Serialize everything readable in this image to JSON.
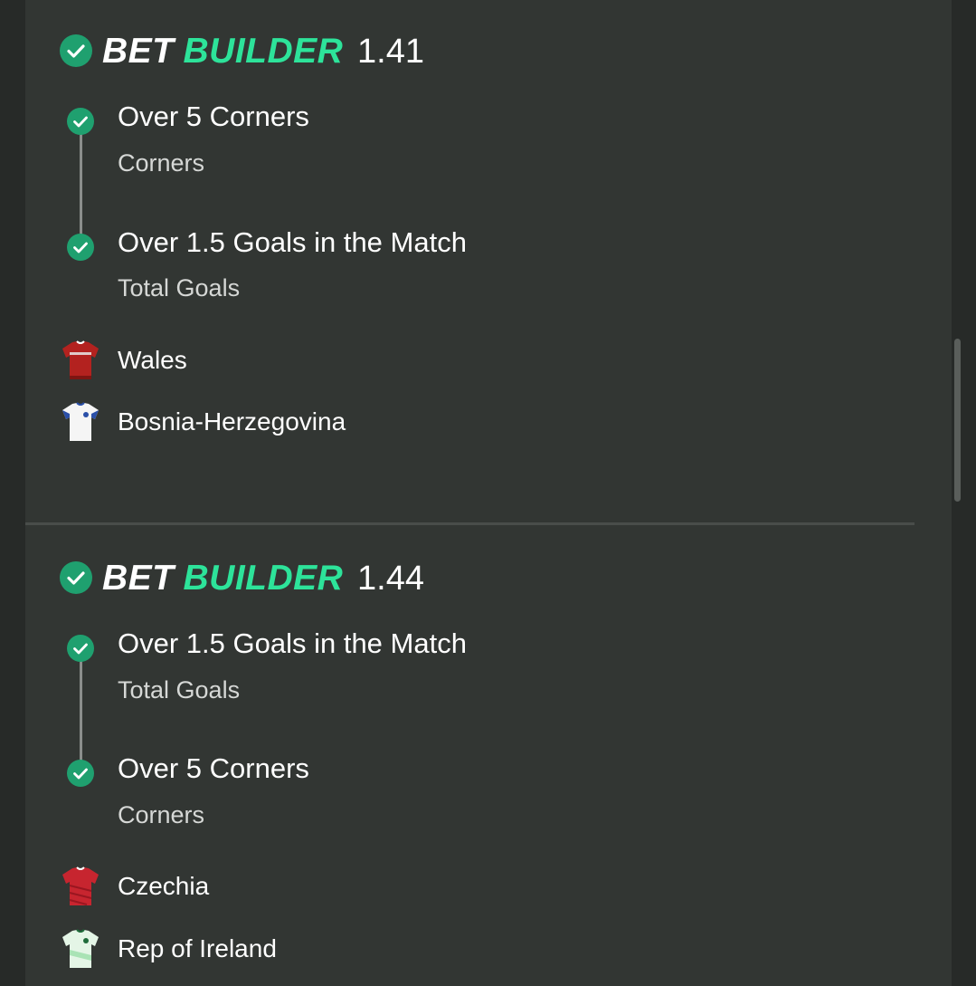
{
  "bets": [
    {
      "brand_bet": "BET",
      "brand_builder": "BUILDER",
      "odds": "1.41",
      "selections": [
        {
          "title": "Over 5 Corners",
          "market": "Corners"
        },
        {
          "title": "Over 1.5 Goals in the Match",
          "market": "Total Goals"
        }
      ],
      "teams": [
        {
          "name": "Wales",
          "shirt": "red-shirt-icon"
        },
        {
          "name": "Bosnia-Herzegovina",
          "shirt": "white-shirt-icon"
        }
      ]
    },
    {
      "brand_bet": "BET",
      "brand_builder": "BUILDER",
      "odds": "1.44",
      "selections": [
        {
          "title": "Over 1.5 Goals in the Match",
          "market": "Total Goals"
        },
        {
          "title": "Over 5 Corners",
          "market": "Corners"
        }
      ],
      "teams": [
        {
          "name": "Czechia",
          "shirt": "red-shirt-icon"
        },
        {
          "name": "Rep of Ireland",
          "shirt": "light-green-shirt-icon"
        }
      ]
    }
  ],
  "colors": {
    "accent": "#2de39a",
    "check": "#1fa06f",
    "panel": "#323633",
    "background": "#272a28"
  }
}
